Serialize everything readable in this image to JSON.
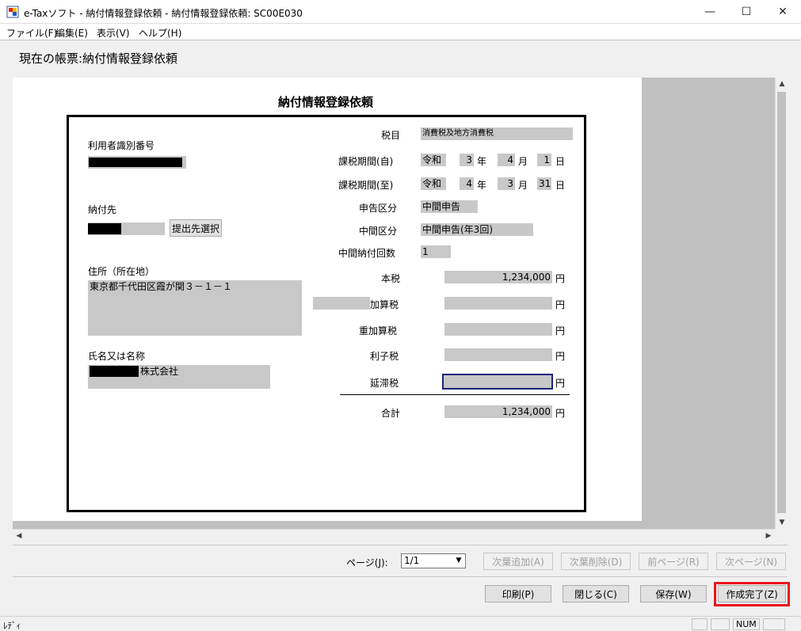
{
  "window": {
    "title": "e-Taxソフト - 納付情報登録依頼 - 納付情報登録依頼: SC00E030",
    "minimize": "—",
    "maximize": "☐",
    "close": "✕"
  },
  "menu": [
    "ファイル(F)",
    "編集(E)",
    "表示(V)",
    "ヘルプ(H)"
  ],
  "current_form": "現在の帳票:納付情報登録依頼",
  "form": {
    "title": "納付情報登録依頼",
    "user_id_label": "利用者識別番号",
    "payee_label": "納付先",
    "select_button": "提出先選択",
    "address_label": "住所（所在地）",
    "address_value": "東京都千代田区霞が関３－１－１",
    "name_label": "氏名又は名称",
    "name_suffix": "株式会社",
    "tax_item_label": "税目",
    "tax_item_value": "消費税及地方消費税",
    "period_from_label": "課税期間(自)",
    "period_to_label": "課税期間(至)",
    "era": "令和",
    "from": {
      "year": "3",
      "month": "4",
      "day": "1"
    },
    "to": {
      "year": "4",
      "month": "3",
      "day": "31"
    },
    "year_unit": "年",
    "month_unit": "月",
    "day_unit": "日",
    "declaration_type_label": "申告区分",
    "declaration_type_value": "中間申告",
    "interim_type_label": "中間区分",
    "interim_type_value": "中間申告(年3回)",
    "interim_count_label": "中間納付回数",
    "interim_count_value": "1",
    "yen": "円",
    "main_tax_label": "本税",
    "main_tax_value": "1,234,000",
    "additional_tax_label": "加算税",
    "heavy_additional_tax_label": "重加算税",
    "interest_tax_label": "利子税",
    "delinquent_tax_label": "延滞税",
    "total_label": "合計",
    "total_value": "1,234,000"
  },
  "pager": {
    "label": "ページ(J):",
    "value": "1/1",
    "add_next": "次葉追加(A)",
    "delete_next": "次葉削除(D)",
    "prev_page": "前ページ(R)",
    "next_page": "次ページ(N)"
  },
  "actions": {
    "print": "印刷(P)",
    "close": "閉じる(C)",
    "save": "保存(W)",
    "complete": "作成完了(Z)"
  },
  "status": {
    "text": "ﾚﾃﾞｨ",
    "num": "NUM"
  },
  "colors": {
    "highlight": "#e8141e",
    "field": "#c8c8c8",
    "focus": "#1a237e"
  }
}
